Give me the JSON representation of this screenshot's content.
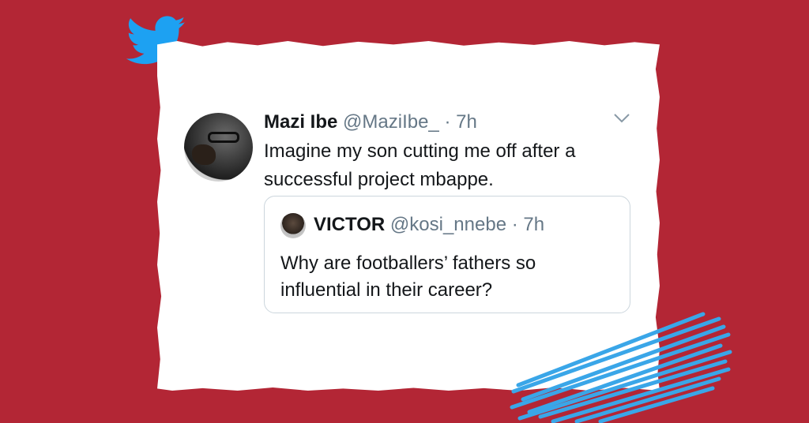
{
  "tweet": {
    "author_name": "Mazi Ibe",
    "handle": "@MaziIbe_",
    "separator": "·",
    "time": "7h",
    "text": "Imagine my son cutting me off after a successful project mbappe."
  },
  "quoted_tweet": {
    "author_name": "VICTOR",
    "handle": "@kosi_nnebe",
    "separator": "·",
    "time": "7h",
    "text": "Why are footballers’ fathers so influential in their career?"
  },
  "icons": {
    "brand": "twitter-bird-icon",
    "menu": "chevron-down-icon"
  },
  "colors": {
    "background": "#b32635",
    "twitter_blue": "#1da1f2",
    "scribble_blue": "#3aa6e8",
    "secondary_text": "#657786"
  }
}
